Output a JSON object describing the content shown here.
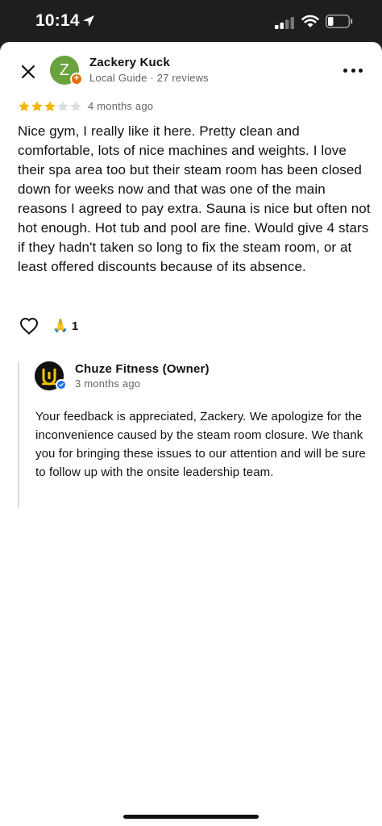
{
  "status_bar": {
    "time": "10:14"
  },
  "review": {
    "reviewer_name": "Zackery Kuck",
    "reviewer_initial": "Z",
    "reviewer_meta": "Local Guide · 27 reviews",
    "rating": 3,
    "rating_max": 5,
    "date": "4 months ago",
    "text": "Nice gym, I really like it here.  Pretty clean and comfortable, lots of nice machines and weights.  I love their spa area too but their steam room has been closed down for weeks now and that was one of the main reasons I agreed to pay extra.  Sauna is nice but often not hot enough.  Hot tub and pool are fine.  Would give 4 stars if they hadn't taken so long to fix the steam room, or at least offered discounts because of its absence.",
    "reaction_emoji": "🙏",
    "reaction_count": "1"
  },
  "owner_response": {
    "name": "Chuze Fitness (Owner)",
    "date": "3 months ago",
    "text": "Your feedback is appreciated, Zackery. We apologize for the inconvenience caused by the steam room closure. We thank you for bringing these issues to our attention and will be sure to follow up with the onsite leadership team."
  },
  "colors": {
    "star_filled": "#f4b400",
    "star_empty": "#dadce0",
    "avatar_bg": "#6aa23d",
    "guide_badge": "#e8710a",
    "verified": "#1a73e8"
  },
  "icons": [
    "location-arrow-icon",
    "signal-icon",
    "wifi-icon",
    "battery-icon",
    "close-icon",
    "more-icon",
    "star-icon",
    "heart-icon",
    "verified-icon"
  ]
}
